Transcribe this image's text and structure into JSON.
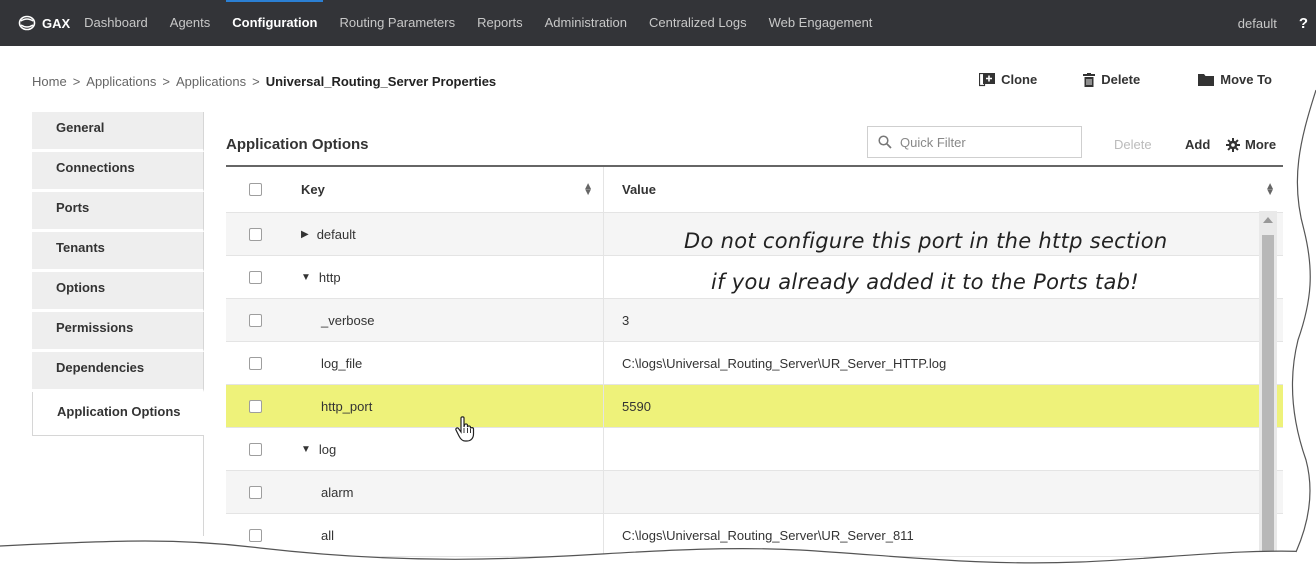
{
  "topnav": {
    "brand": "GAX",
    "items": [
      "Dashboard",
      "Agents",
      "Configuration",
      "Routing Parameters",
      "Reports",
      "Administration",
      "Centralized Logs",
      "Web Engagement"
    ],
    "active": "Configuration",
    "user": "default",
    "help": "?"
  },
  "breadcrumb": {
    "items": [
      "Home",
      "Applications",
      "Applications"
    ],
    "separator": ">",
    "current": "Universal_Routing_Server Properties"
  },
  "page_actions": {
    "clone": "Clone",
    "delete": "Delete",
    "move_to": "Move To"
  },
  "sidebar": {
    "items": [
      "General",
      "Connections",
      "Ports",
      "Tenants",
      "Options",
      "Permissions",
      "Dependencies",
      "Application Options"
    ],
    "active": "Application Options"
  },
  "panel": {
    "title": "Application Options",
    "filter_placeholder": "Quick Filter",
    "delete": "Delete",
    "add": "Add",
    "more": "More"
  },
  "table": {
    "columns": [
      "Key",
      "Value"
    ],
    "rows": [
      {
        "key": "default",
        "value": "",
        "caret": "▶"
      },
      {
        "key": "http",
        "value": "",
        "caret": "▼"
      },
      {
        "key": "_verbose",
        "value": "3"
      },
      {
        "key": "log_file",
        "value": "C:\\logs\\Universal_Routing_Server\\UR_Server_HTTP.log"
      },
      {
        "key": "http_port",
        "value": "5590",
        "highlighted": true
      },
      {
        "key": "log",
        "value": "",
        "caret": "▼"
      },
      {
        "key": "alarm",
        "value": ""
      },
      {
        "key": "all",
        "value": "C:\\logs\\Universal_Routing_Server\\UR_Server_811"
      }
    ]
  },
  "annotation": {
    "line1": "Do not configure this port in the http section",
    "line2": "if you already added it to the Ports tab!"
  },
  "colors": {
    "nav_bg": "#333438",
    "active_accent": "#2b7fd3",
    "highlight_row": "#eef27a"
  }
}
